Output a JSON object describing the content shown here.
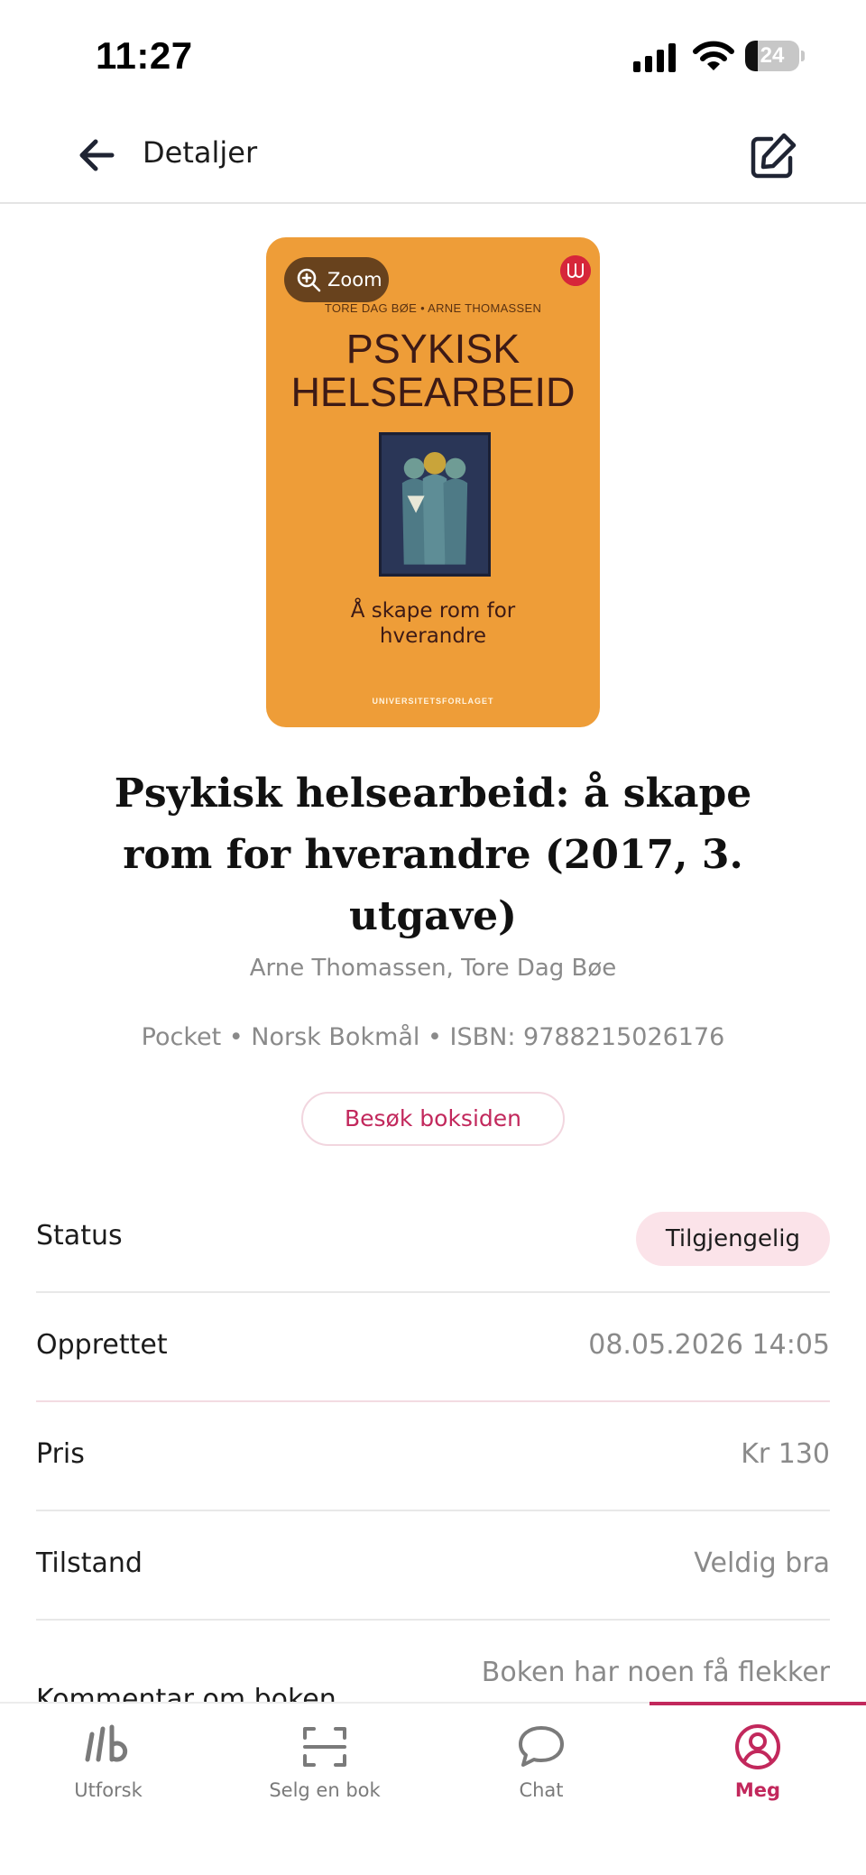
{
  "status_bar": {
    "time": "11:27",
    "battery_level": "24",
    "battery_fraction": 0.24
  },
  "header": {
    "title": "Detaljer",
    "back_icon": "arrow-left-icon",
    "edit_icon": "edit-icon"
  },
  "cover": {
    "zoom_label": "Zoom",
    "authors_line": "TORE DAG BØE • ARNE THOMASSEN",
    "title_line1": "PSYKISK",
    "title_line2": "HELSEARBEID",
    "subtitle_line1": "Å skape rom for",
    "subtitle_line2": "hverandre",
    "publisher": "UNIVERSITETSFORLAGET"
  },
  "book": {
    "title": "Psykisk helsearbeid: å skape rom for hverandre (2017, 3. utgave)",
    "authors": "Arne Thomassen, Tore Dag Bøe",
    "meta": "Pocket • Norsk Bokmål • ISBN: 9788215026176",
    "visit_button": "Besøk boksiden"
  },
  "details": {
    "status_label": "Status",
    "status_value": "Tilgjengelig",
    "created_label": "Opprettet",
    "created_value": "08.05.2026 14:05",
    "price_label": "Pris",
    "price_value": "Kr 130",
    "condition_label": "Tilstand",
    "condition_value": "Veldig bra",
    "comment_label": "Kommentar om boken",
    "comment_value": "Boken har noen få flekker"
  },
  "colors": {
    "accent": "#c2285c",
    "badge_bg": "#fbe3e9",
    "cover_bg": "#ee9d38"
  },
  "tabs": [
    {
      "label": "Utforsk",
      "icon": "logo-icon",
      "active": false
    },
    {
      "label": "Selg en bok",
      "icon": "scan-icon",
      "active": false
    },
    {
      "label": "Chat",
      "icon": "chat-bubble-icon",
      "active": false
    },
    {
      "label": "Meg",
      "icon": "profile-icon",
      "active": true
    }
  ]
}
